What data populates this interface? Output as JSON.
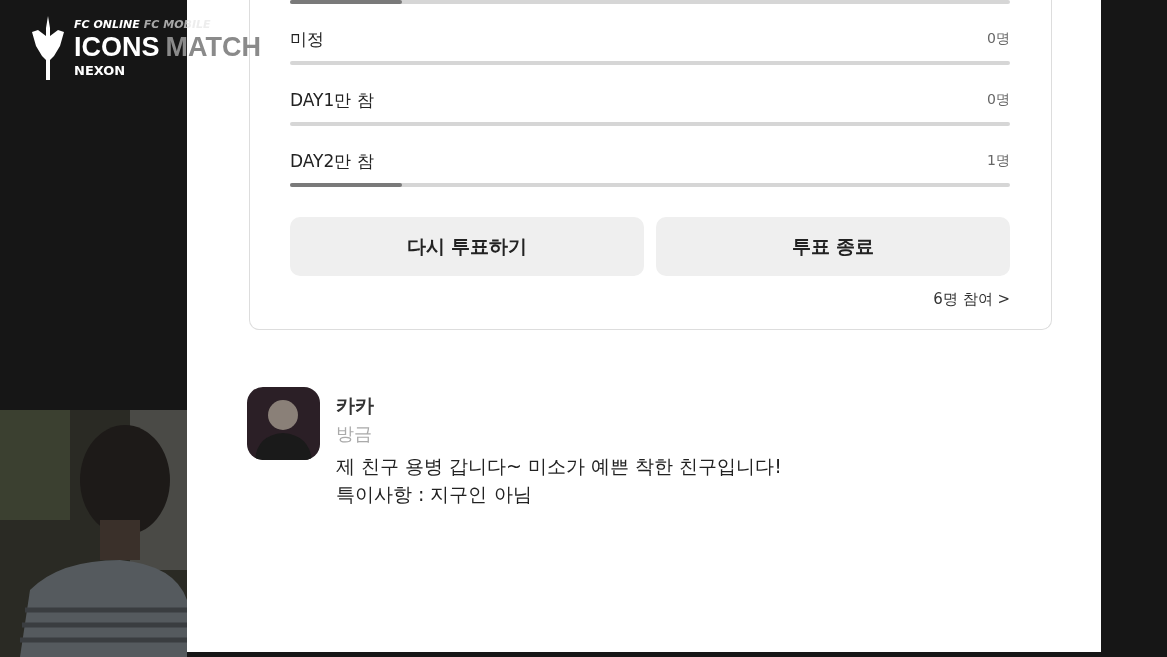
{
  "overlay_logo": {
    "brands": [
      "FC ONLINE",
      "FC MOBILE"
    ],
    "title": "ICONS",
    "title_faded": "MATCH",
    "publisher": "NEXON"
  },
  "poll": {
    "cut_bar": {
      "level": 0.155
    },
    "options": [
      {
        "label": "미정",
        "count": "0명"
      },
      {
        "label": "DAY1만 참",
        "count": "0명"
      },
      {
        "label": "DAY2만 참",
        "count": "1명",
        "level": 0.155
      }
    ],
    "buttons": [
      "다시 투표하기",
      "투표 종료"
    ],
    "participants": "6명 참여 >"
  },
  "comment": {
    "author": "카카",
    "time": "방금",
    "lines": [
      "제 친구 용병 갑니다~ 미소가 예쁜 착한 친구입니다!",
      "특이사항 : 지구인 아님"
    ]
  }
}
